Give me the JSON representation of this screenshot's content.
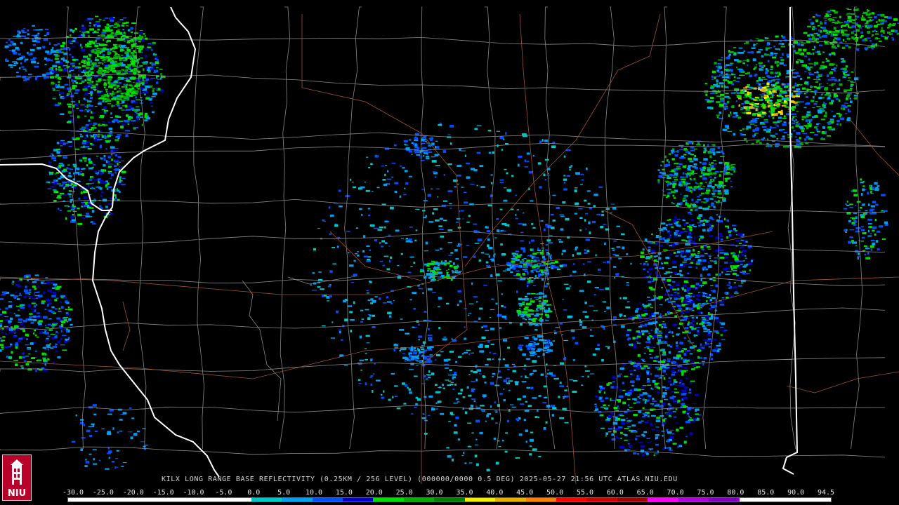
{
  "caption": "KILX LONG RANGE BASE REFLECTIVITY (0.25KM / 256 LEVEL) (000000/0000 0.5 DEG) 2025-05-27 21:56 UTC  ATLAS.NIU.EDU",
  "logo": {
    "text": "NIU",
    "icon": "niu-tower-logo-icon"
  },
  "colors": {
    "background": "#000000",
    "county_lines": "#8a8a8a",
    "state_lines": "#ffffff",
    "roads": "#a0522d"
  },
  "colorbar": {
    "labels": [
      "-30.0",
      "-25.0",
      "-20.0",
      "-15.0",
      "-10.0",
      "-5.0",
      "0.0",
      "5.0",
      "10.0",
      "15.0",
      "20.0",
      "25.0",
      "30.0",
      "35.0",
      "40.0",
      "45.0",
      "50.0",
      "55.0",
      "60.0",
      "65.0",
      "70.0",
      "75.0",
      "80.0",
      "85.0",
      "90.0",
      "94.5"
    ],
    "colors": [
      "#ffffff",
      "#ffffff",
      "#ffffff",
      "#ffffff",
      "#ffffff",
      "#ffffff",
      "#00c8c8",
      "#00a0f0",
      "#0050ff",
      "#0000c8",
      "#00e000",
      "#00b000",
      "#008000",
      "#f0f000",
      "#e8b000",
      "#ff8000",
      "#ff0000",
      "#d00000",
      "#a00000",
      "#ff00ff",
      "#b000e0",
      "#8000c0",
      "#ffffff",
      "#ffffff",
      "#ffffff"
    ]
  }
}
